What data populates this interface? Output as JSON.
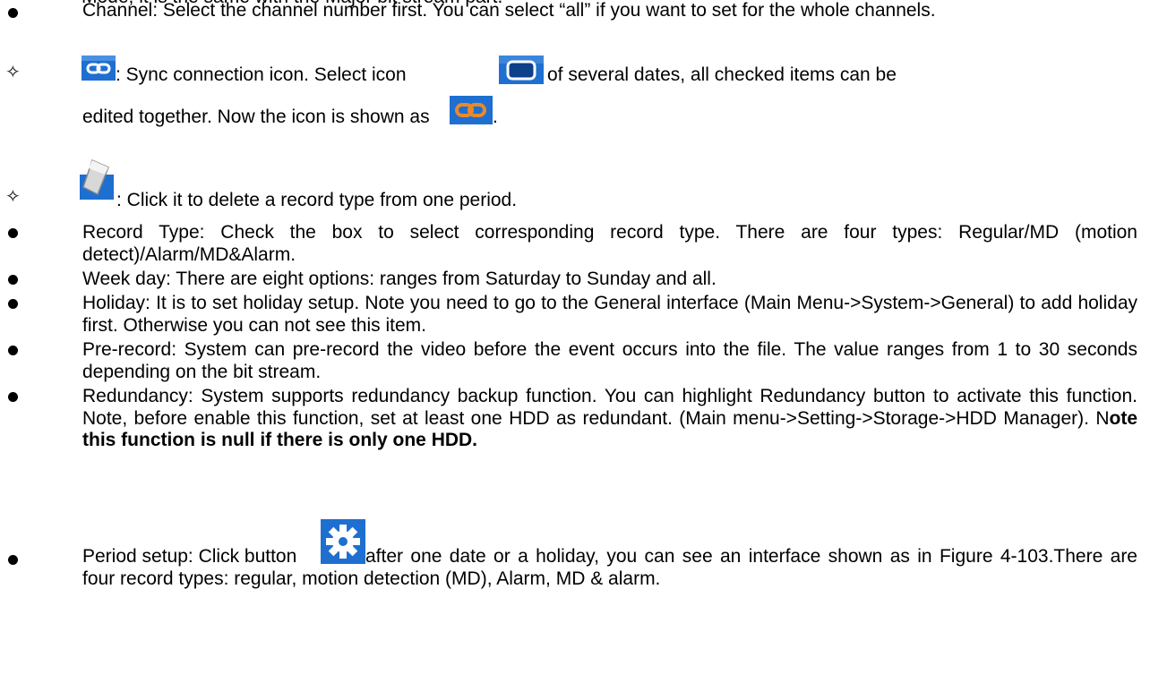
{
  "top_fragment": "Mode, it is the same with the Major bit stream part.",
  "items": {
    "channel": "Channel: Select the channel number first. You can select “all” if you want to set for the whole channels.",
    "sync_a": ": Sync connection icon. Select icon",
    "sync_b": "of several dates, all checked items can be",
    "sync_c": "edited together. Now the icon is shown as",
    "sync_c_end": ".",
    "delete": ": Click it to delete a record type from one period.",
    "record_type": "Record Type: Check the box to select corresponding record type. There are four types: Regular/MD (motion detect)/Alarm/MD&Alarm.",
    "week_day": "Week day: There are eight options: ranges from Saturday to Sunday and all.",
    "holiday": "Holiday: It is to set holiday setup. Note you need to go to the General interface (Main Menu->System->General) to add holiday first. Otherwise you can not see this item.",
    "pre_record": "Pre-record: System can pre-record the video before the event occurs into the file. The value ranges from 1 to 30 seconds depending on the bit stream.",
    "redundancy_text": "Redundancy: System supports redundancy backup function.  You can highlight Redundancy button to activate this function. Note, before enable this function, set at least one HDD as redundant. (Main menu->Setting->Storage->HDD Manager). N",
    "redundancy_bold": "ote this function is null if there is only one HDD.",
    "period_a": "Period setup: Click button",
    "period_b": "after one date or a holiday, you can see an interface shown as in Figure 4-103.There are four record types: regular, motion detection (MD), Alarm, MD & alarm."
  },
  "icons": {
    "sync": "link-chain-icon",
    "checkbox": "rounded-square-icon",
    "sync_active": "orange-link-chain-icon",
    "delete": "eraser-icon",
    "settings": "gear-icon"
  },
  "colors": {
    "icon_blue": "#1e6fd0",
    "icon_blue_dark": "#0d3f8a",
    "active_orange": "#e8892a"
  }
}
